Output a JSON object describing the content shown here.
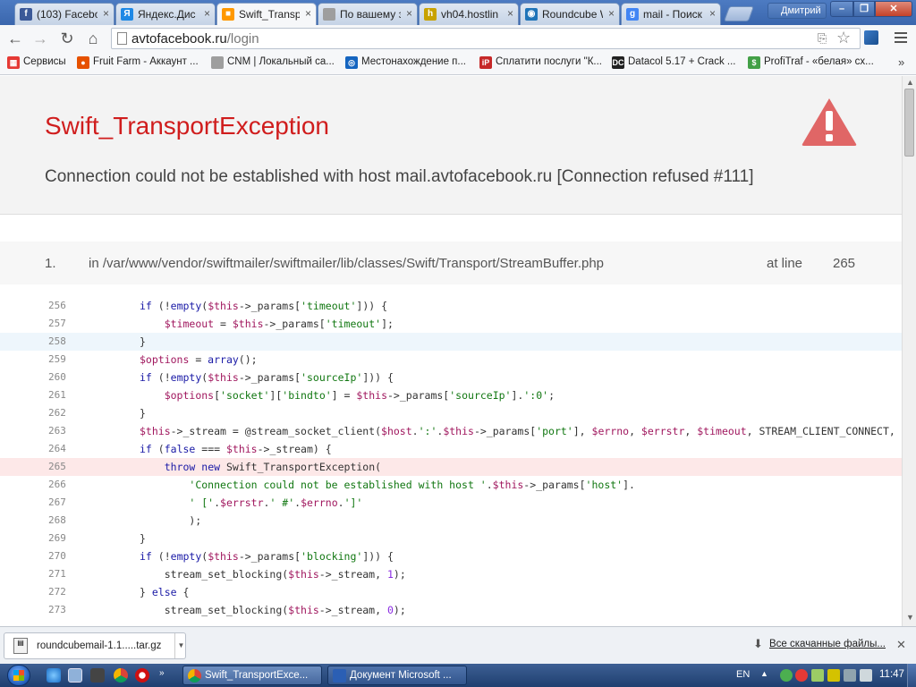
{
  "browser": {
    "tabs": [
      {
        "title": "(103) Facebo",
        "favicon": "facebook-icon",
        "color": "#3b5998",
        "glyph": "f"
      },
      {
        "title": "Яндекс.Дис",
        "favicon": "yandex-disk-icon",
        "color": "#1e88e5",
        "glyph": "Я"
      },
      {
        "title": "Swift_Transp",
        "favicon": "windows-flag-icon",
        "color": "#ff9800",
        "glyph": "■"
      },
      {
        "title": "По вашему з",
        "favicon": "page-icon",
        "color": "#9e9e9e",
        "glyph": ""
      },
      {
        "title": "vh04.hostlin",
        "favicon": "hostline-icon",
        "color": "#c8a200",
        "glyph": "h"
      },
      {
        "title": "Roundcube W",
        "favicon": "roundcube-icon",
        "color": "#1f74b8",
        "glyph": "◉"
      },
      {
        "title": "mail - Поиск",
        "favicon": "google-icon",
        "color": "#4285f4",
        "glyph": "g"
      }
    ],
    "active_tab": 2,
    "profile_name": "Дмитрий",
    "url_host": "avtofacebook.ru",
    "url_path": "/login",
    "bookmarks": [
      {
        "label": "Сервисы",
        "icon": "apps-icon",
        "color": "#e53935",
        "glyph": "▦"
      },
      {
        "label": "Fruit Farm - Аккаунт ...",
        "icon": "fruit-icon",
        "color": "#e65100",
        "glyph": "●"
      },
      {
        "label": "CNM | Локальный са...",
        "icon": "page-icon",
        "color": "#9e9e9e",
        "glyph": ""
      },
      {
        "label": "Местонахождение п...",
        "icon": "globe-icon",
        "color": "#1565c0",
        "glyph": "◎"
      },
      {
        "label": "Сплатити послуги \"К...",
        "icon": "ip-icon",
        "color": "#c62828",
        "glyph": "iP"
      },
      {
        "label": "Datacol 5.17 + Crack ...",
        "icon": "datacol-icon",
        "color": "#212121",
        "glyph": "DC"
      },
      {
        "label": "ProfiTraf - «белая» сх...",
        "icon": "profitraf-icon",
        "color": "#43a047",
        "glyph": "$"
      }
    ]
  },
  "error": {
    "exception_name": "Swift_TransportException",
    "message": "Connection could not be established with host mail.avtofacebook.ru [Connection refused #111]",
    "warning_color": "#e06666"
  },
  "frame": {
    "number": "1.",
    "file": "in /var/www/vendor/swiftmailer/swiftmailer/lib/classes/Swift/Transport/StreamBuffer.php",
    "at_line_label": "at line",
    "line": "265"
  },
  "code_lines": [
    {
      "n": "256",
      "state": "normal",
      "html": "<span class='k'>if</span> (!<span class='k'>empty</span>(<span class='v'>$this</span>-&gt;_params[<span class='s'>'timeout'</span>])) {"
    },
    {
      "n": "257",
      "state": "normal",
      "html": "    <span class='v'>$timeout</span> = <span class='v'>$this</span>-&gt;_params[<span class='s'>'timeout'</span>];"
    },
    {
      "n": "258",
      "state": "hover",
      "html": "}"
    },
    {
      "n": "259",
      "state": "normal",
      "html": "<span class='v'>$options</span> = <span class='k'>array</span>();"
    },
    {
      "n": "260",
      "state": "normal",
      "html": "<span class='k'>if</span> (!<span class='k'>empty</span>(<span class='v'>$this</span>-&gt;_params[<span class='s'>'sourceIp'</span>])) {"
    },
    {
      "n": "261",
      "state": "normal",
      "html": "    <span class='v'>$options</span>[<span class='s'>'socket'</span>][<span class='s'>'bindto'</span>] = <span class='v'>$this</span>-&gt;_params[<span class='s'>'sourceIp'</span>].<span class='s'>':0'</span>;"
    },
    {
      "n": "262",
      "state": "normal",
      "html": "}"
    },
    {
      "n": "263",
      "state": "normal",
      "html": "<span class='v'>$this</span>-&gt;_stream = @stream_socket_client(<span class='v'>$host</span>.<span class='s'>':'</span>.<span class='v'>$this</span>-&gt;_params[<span class='s'>'port'</span>], <span class='v'>$errno</span>, <span class='v'>$errstr</span>, <span class='v'>$timeout</span>, STREAM_CLIENT_CONNECT,"
    },
    {
      "n": "264",
      "state": "normal",
      "html": "<span class='k'>if</span> (<span class='k'>false</span> === <span class='v'>$this</span>-&gt;_stream) {"
    },
    {
      "n": "265",
      "state": "error",
      "html": "    <span class='k'>throw</span> <span class='k'>new</span> Swift_TransportException("
    },
    {
      "n": "266",
      "state": "normal",
      "html": "        <span class='s'>'Connection could not be established with host '</span>.<span class='v'>$this</span>-&gt;_params[<span class='s'>'host'</span>]."
    },
    {
      "n": "267",
      "state": "normal",
      "html": "        <span class='s'>' ['</span>.<span class='v'>$errstr</span>.<span class='s'>' #'</span>.<span class='v'>$errno</span>.<span class='s'>']'</span>"
    },
    {
      "n": "268",
      "state": "normal",
      "html": "        );"
    },
    {
      "n": "269",
      "state": "normal",
      "html": "}"
    },
    {
      "n": "270",
      "state": "normal",
      "html": "<span class='k'>if</span> (!<span class='k'>empty</span>(<span class='v'>$this</span>-&gt;_params[<span class='s'>'blocking'</span>])) {"
    },
    {
      "n": "271",
      "state": "normal",
      "html": "    stream_set_blocking(<span class='v'>$this</span>-&gt;_stream, <span class='c'>1</span>);"
    },
    {
      "n": "272",
      "state": "normal",
      "html": "} <span class='k'>else</span> {"
    },
    {
      "n": "273",
      "state": "normal",
      "html": "    stream_set_blocking(<span class='v'>$this</span>-&gt;_stream, <span class='c'>0</span>);"
    }
  ],
  "downloads": {
    "file_name": "roundcubemail-1.1.....tar.gz",
    "show_all_label": "Все скачанные файлы..."
  },
  "taskbar": {
    "buttons": [
      {
        "label": "Swift_TransportExce...",
        "icon": "chrome-icon",
        "active": true
      },
      {
        "label": "Документ Microsoft ...",
        "icon": "word-icon",
        "active": false
      }
    ],
    "language": "EN",
    "time": "11:47"
  }
}
